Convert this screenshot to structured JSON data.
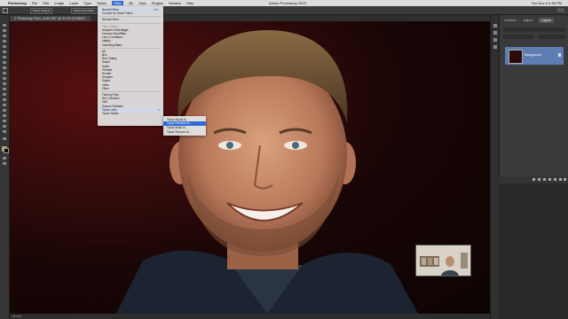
{
  "menubar": {
    "items": [
      "Photoshop",
      "File",
      "Edit",
      "Image",
      "Layer",
      "Type",
      "Select",
      "Filter",
      "3D",
      "View",
      "Plugins",
      "Window",
      "Help"
    ],
    "title": "Adobe Photoshop 2023",
    "clock": "Tue Nov 8  3:48 PM"
  },
  "options": {
    "select_subject": "Select Subject",
    "select_and_mask": "Select and Mask..."
  },
  "document": {
    "tab_label": "© Photoshop Parts_0460.NEF @ 33.3% (RGB/8*)",
    "status": "33.33%"
  },
  "filter_menu": {
    "items": [
      {
        "label": "Neural Filters",
        "shortcut": "^⌘F",
        "hl": true
      },
      {
        "label": "Convert for Smart Filters"
      },
      {
        "sep": true
      },
      {
        "label": "Neural Filters..."
      },
      {
        "sep": true
      },
      {
        "label": "Filter Gallery...",
        "dim": true
      },
      {
        "label": "Adaptive Wide Angle...",
        "shortcut": "⌥⇧⌘A"
      },
      {
        "label": "Camera Raw Filter...",
        "shortcut": "⇧⌘A"
      },
      {
        "label": "Lens Correction...",
        "shortcut": "⇧⌘R"
      },
      {
        "label": "Liquify...",
        "shortcut": "⇧⌘X"
      },
      {
        "label": "Vanishing Point...",
        "shortcut": "⌥⌘V"
      },
      {
        "sep": true
      },
      {
        "label": "3D",
        "arrow": true
      },
      {
        "label": "Blur",
        "arrow": true
      },
      {
        "label": "Blur Gallery",
        "arrow": true
      },
      {
        "label": "Distort",
        "arrow": true
      },
      {
        "label": "Noise",
        "arrow": true
      },
      {
        "label": "Pixelate",
        "arrow": true
      },
      {
        "label": "Render",
        "arrow": true
      },
      {
        "label": "Sharpen",
        "arrow": true
      },
      {
        "label": "Stylize",
        "arrow": true
      },
      {
        "label": "Video",
        "arrow": true
      },
      {
        "label": "Other",
        "arrow": true
      },
      {
        "sep": true
      },
      {
        "label": "Flaming Pear",
        "arrow": true
      },
      {
        "label": "Nik Collection",
        "arrow": true
      },
      {
        "label": "ON1",
        "arrow": true
      },
      {
        "label": "Skylum Software",
        "arrow": true
      },
      {
        "label": "Topaz Labs",
        "arrow": true,
        "hl": true
      },
      {
        "label": "Topaz Studio",
        "arrow": true
      }
    ]
  },
  "submenu": {
    "items": [
      {
        "label": "Topaz Adjust AI..."
      },
      {
        "label": "Topaz DeNoise AI...",
        "selected": true
      },
      {
        "label": "Topaz Mask AI..."
      },
      {
        "label": "Topaz Sharpen AI..."
      }
    ]
  },
  "panel": {
    "tabs": [
      "Libraries",
      "Adjust",
      "Layers"
    ],
    "active_tab": "Layers",
    "layer_name": "Background"
  },
  "colors": {
    "menu_bg": "#e4e4e4",
    "selected": "#2f6bd6",
    "layer_selected": "#5d7db3",
    "canvas_red": "#5a0f0f"
  }
}
